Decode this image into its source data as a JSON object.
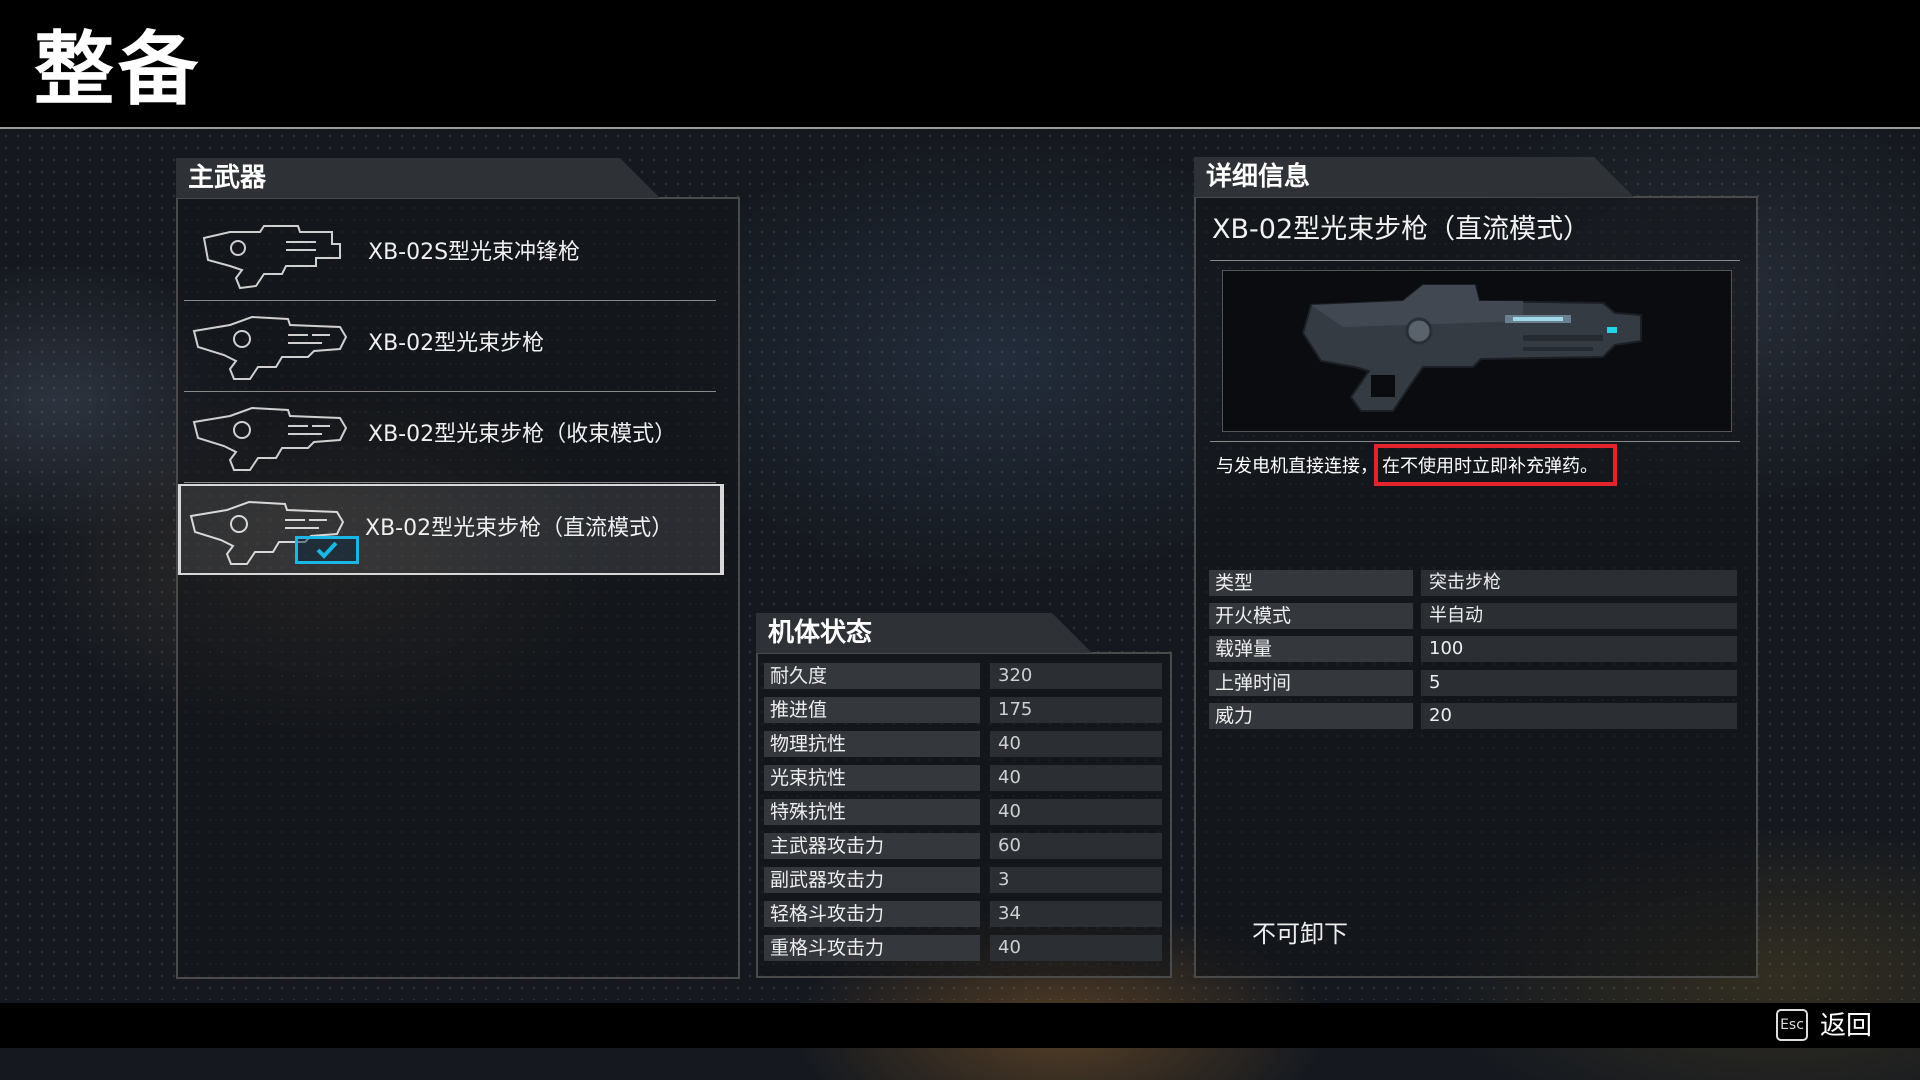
{
  "header": {
    "title": "整备"
  },
  "weapon_panel": {
    "tab_label": "主武器",
    "items": [
      {
        "name": "XB-02S型光束冲锋枪",
        "equipped": false
      },
      {
        "name": "XB-02型光束步枪",
        "equipped": false
      },
      {
        "name": "XB-02型光束步枪（收束模式）",
        "equipped": false
      },
      {
        "name": "XB-02型光束步枪（直流模式）",
        "equipped": true
      }
    ]
  },
  "status_panel": {
    "tab_label": "机体状态",
    "rows": [
      {
        "label": "耐久度",
        "value": "320"
      },
      {
        "label": "推进值",
        "value": "175"
      },
      {
        "label": "物理抗性",
        "value": "40"
      },
      {
        "label": "光束抗性",
        "value": "40"
      },
      {
        "label": "特殊抗性",
        "value": "40"
      },
      {
        "label": "主武器攻击力",
        "value": "60"
      },
      {
        "label": "副武器攻击力",
        "value": "3"
      },
      {
        "label": "轻格斗攻击力",
        "value": "34"
      },
      {
        "label": "重格斗攻击力",
        "value": "40"
      }
    ]
  },
  "detail_panel": {
    "tab_label": "详细信息",
    "weapon_name": "XB-02型光束步枪（直流模式）",
    "description_plain": "与发电机直接连接，",
    "description_highlight": "在不使用时立即补充弹药。",
    "stats": [
      {
        "label": "类型",
        "value": "突击步枪"
      },
      {
        "label": "开火模式",
        "value": "半自动"
      },
      {
        "label": "载弹量",
        "value": "100"
      },
      {
        "label": "上弹时间",
        "value": "5"
      },
      {
        "label": "威力",
        "value": "20"
      }
    ],
    "note": "不可卸下"
  },
  "footer": {
    "esc_key": "Esc",
    "back_label": "返回"
  },
  "colors": {
    "highlight_border": "#e3242b",
    "equip_accent": "#19b6e6"
  },
  "icons": [
    "beam-rifle-icon",
    "check-icon",
    "esc-key-icon"
  ]
}
